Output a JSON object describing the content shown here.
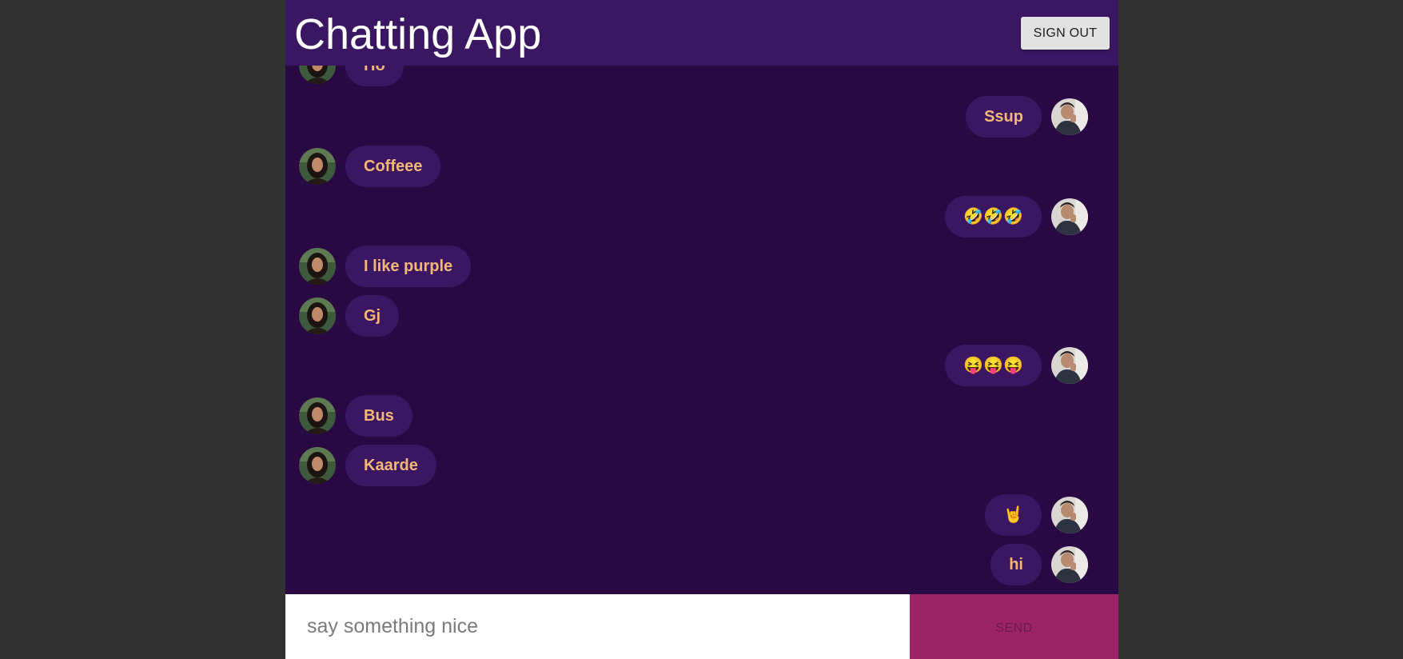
{
  "app": {
    "title": "Chatting App",
    "sign_out_label": "SIGN OUT"
  },
  "messages": [
    {
      "side": "recv",
      "text": "Ho",
      "user": "her"
    },
    {
      "side": "sent",
      "text": "Ssup",
      "user": "him"
    },
    {
      "side": "recv",
      "text": "Coffeee",
      "user": "her"
    },
    {
      "side": "sent",
      "text": "🤣🤣🤣",
      "user": "him"
    },
    {
      "side": "recv",
      "text": "I like purple",
      "user": "her"
    },
    {
      "side": "recv",
      "text": "Gj",
      "user": "her"
    },
    {
      "side": "sent",
      "text": "😝😝😝",
      "user": "him"
    },
    {
      "side": "recv",
      "text": "Bus",
      "user": "her"
    },
    {
      "side": "recv",
      "text": "Kaarde",
      "user": "her"
    },
    {
      "side": "sent",
      "text": "🤘",
      "user": "him"
    },
    {
      "side": "sent",
      "text": "hi",
      "user": "him"
    }
  ],
  "composer": {
    "placeholder": "say something nice",
    "value": "",
    "send_label": "SEND"
  },
  "colors": {
    "page_background": "#323232",
    "chat_background": "#290843",
    "header_background": "#3b1763",
    "bubble_background": "#3b1763",
    "bubble_text": "#f4b876",
    "send_button": "#9c2367"
  }
}
